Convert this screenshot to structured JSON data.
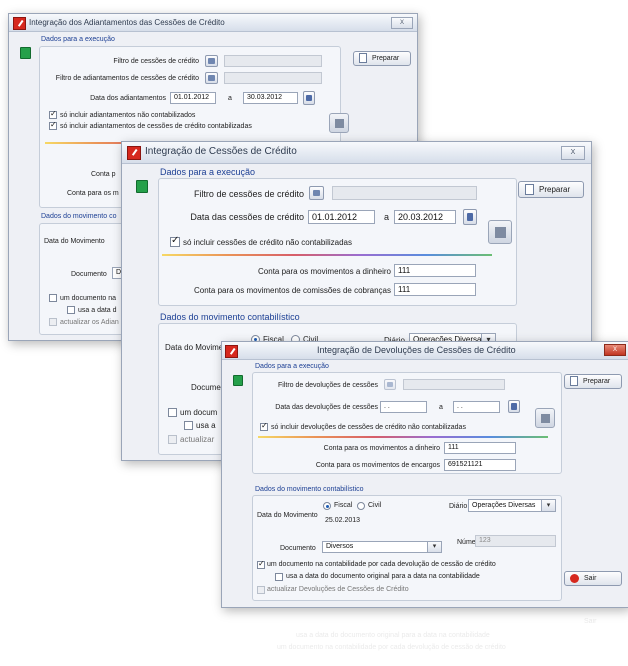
{
  "w1": {
    "title": "Integração dos Adiantamentos das Cessões de Crédito",
    "close": "X",
    "section_exec": "Dados para a execução",
    "filtro_cessoes": "Filtro de cessões de crédito",
    "filtro_adiant": "Filtro de adiantamentos de cessões de crédito",
    "data_adiant": "Data dos adiantamentos",
    "data_de": "01.01.2012",
    "sep": "a",
    "data_ate": "30.03.2012",
    "chk1": "só incluir adiantamentos não contabilizados",
    "chk2": "só incluir adiantamentos de cessões de crédito contabilizadas",
    "conta_1": "Conta p",
    "conta_2": "Conta para os m",
    "section_mov": "Dados do movimento co",
    "data_mov": "Data do Movimento",
    "documento": "Documento",
    "doc_value": "Di",
    "chk_um_doc": "um documento na",
    "chk_usa": "usa a data d",
    "chk_actual": "actualizar os Adian",
    "btn_preparar": "Preparar"
  },
  "w2": {
    "title": "Integração de Cessões de Crédito",
    "close": "X",
    "section_exec": "Dados para a execução",
    "filtro": "Filtro de cessões de crédito",
    "data_label": "Data das cessões de crédito",
    "data_de": "01.01.2012",
    "sep": "a",
    "data_ate": "20.03.2012",
    "chk1": "só incluir cessões de crédito não contabilizadas",
    "conta_dinheiro": "Conta para os movimentos a dinheiro",
    "conta_dinheiro_val": "111",
    "conta_comissoes": "Conta para os movimentos de comissões de cobranças",
    "conta_comissoes_val": "111",
    "section_mov": "Dados do movimento contabilístico",
    "data_mov": "Data do Movime",
    "radio_fiscal": "Fiscal",
    "radio_civil": "Civil",
    "diario": "Diário",
    "diario_val": "Operações Diversas",
    "documento": "Docume",
    "chk_um_doc": "um docum",
    "chk_usa": "usa a",
    "chk_actual": "actualizar",
    "btn_preparar": "Preparar"
  },
  "w3": {
    "title": "Integração de Devoluções de Cessões de Crédito",
    "close": "X",
    "section_exec": "Dados para a execução",
    "filtro": "Filtro de devoluções de cessões",
    "data_label": "Data das devoluções de cessões",
    "data_de": ". .",
    "sep": "a",
    "data_ate": ". .",
    "chk1": "só incluir devoluções de cessões de crédito não contabilizadas",
    "conta_dinheiro": "Conta para os movimentos a dinheiro",
    "conta_dinheiro_val": "111",
    "conta_encargos": "Conta para os movimentos de encargos",
    "conta_encargos_val": "691521121",
    "section_mov": "Dados do movimento contabilístico",
    "data_mov": "Data do Movimento",
    "radio_fiscal": "Fiscal",
    "radio_civil": "Civil",
    "data_mov_val": "25.02.2013",
    "diario": "Diário",
    "diario_val": "Operações Diversas",
    "documento": "Documento",
    "documento_val": "Diversos",
    "numero": "Número",
    "numero_val": "123",
    "chk_um_doc": "um documento na contabilidade por cada devolução de cessão de crédito",
    "chk_usa": "usa a data do documento original para a data na contabilidade",
    "chk_actual": "actualizar Devoluções de Cessões de Crédito",
    "btn_preparar": "Preparar",
    "btn_sair": "Sair"
  },
  "reflection": {
    "sair": "Sair",
    "line1": "usa a data do documento original para a data na contabilidade",
    "line2": "um documento na contabilidade por cada devolução de cessão de crédito"
  }
}
